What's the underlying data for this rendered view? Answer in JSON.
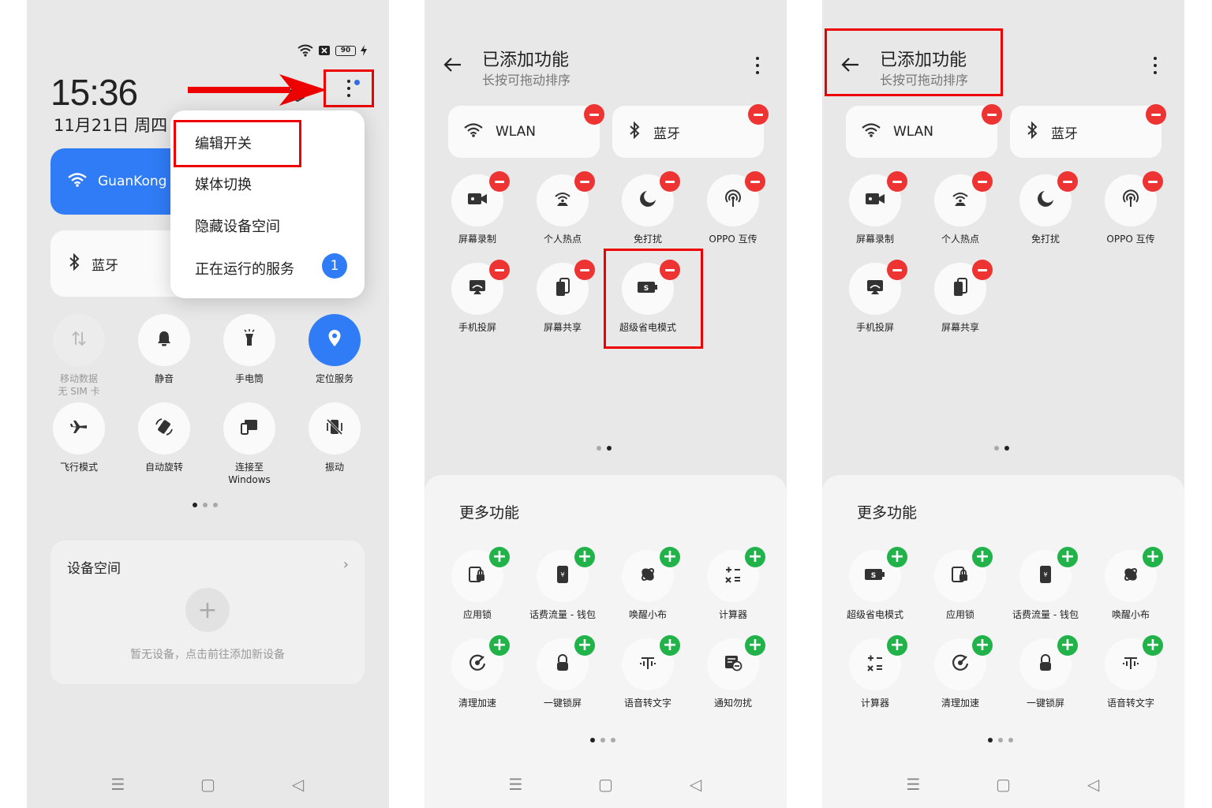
{
  "panel1": {
    "battery": "90",
    "time": "15:36",
    "date": "11月21日 周四",
    "wlan_label": "GuanKong",
    "bt_label": "蓝牙",
    "menu": {
      "items": [
        "编辑开关",
        "媒体切换",
        "隐藏设备空间",
        "正在运行的服务"
      ],
      "badge": "1"
    },
    "tiles": [
      {
        "label": "移动数据",
        "sub": "无 SIM 卡"
      },
      {
        "label": "静音"
      },
      {
        "label": "手电筒"
      },
      {
        "label": "定位服务"
      },
      {
        "label": "飞行模式"
      },
      {
        "label": "自动旋转"
      },
      {
        "label": "连接至",
        "sub": "Windows"
      },
      {
        "label": "振动"
      }
    ],
    "device_card": {
      "title": "设备空间",
      "empty": "暂无设备，点击前往添加新设备"
    }
  },
  "panel2": {
    "title": "已添加功能",
    "subtitle": "长按可拖动排序",
    "wlan": "WLAN",
    "bt": "蓝牙",
    "added": [
      "屏幕录制",
      "个人热点",
      "免打扰",
      "OPPO 互传",
      "手机投屏",
      "屏幕共享",
      "超级省电模式"
    ],
    "more_title": "更多功能",
    "more": [
      "应用锁",
      "话费流量 - 钱包",
      "唤醒小布",
      "计算器",
      "清理加速",
      "一键锁屏",
      "语音转文字",
      "通知勿扰"
    ]
  },
  "panel3": {
    "title": "已添加功能",
    "subtitle": "长按可拖动排序",
    "wlan": "WLAN",
    "bt": "蓝牙",
    "added": [
      "屏幕录制",
      "个人热点",
      "免打扰",
      "OPPO 互传",
      "手机投屏",
      "屏幕共享"
    ],
    "more_title": "更多功能",
    "more": [
      "超级省电模式",
      "应用锁",
      "话费流量 - 钱包",
      "唤醒小布",
      "计算器",
      "清理加速",
      "一键锁屏",
      "语音转文字"
    ]
  },
  "colors": {
    "accent": "#2f7cf6",
    "remove": "#e33333",
    "add": "#21b24a",
    "highlight": "#ee0000"
  }
}
